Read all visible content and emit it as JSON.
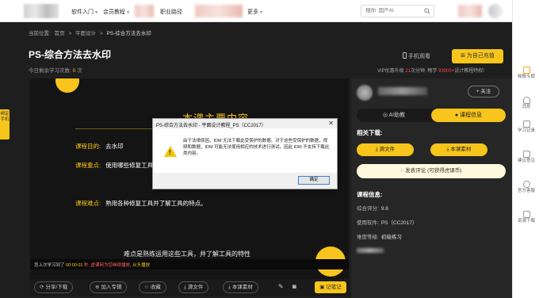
{
  "nav": {
    "items": [
      "软件入门",
      "会员教程",
      "职业路径",
      "更多"
    ],
    "search_placeholder": "搜你: 国产AI"
  },
  "right_sidebar": {
    "items": [
      "释教专题",
      "消息",
      "学习记录",
      "建议意见",
      "官方客服",
      "资源下载"
    ]
  },
  "left_tab": {
    "label": "绑定手机"
  },
  "breadcrumb": {
    "prefix": "当前位置:",
    "items": [
      "首页",
      "平面设计",
      "PS-综合方法去水印"
    ],
    "separator": ">"
  },
  "page": {
    "title": "PS-综合方法去水印",
    "study_label": "今日剩余学习次数:",
    "study_count": "0",
    "study_unit": "次",
    "mobile_watch": "手机观看",
    "vip_button": "为自己充值",
    "vip_text_pre": "VIP优惠升级",
    "vip_days": "21",
    "vip_text_mid": "次分钟, 畅学",
    "vip_count": "93000+",
    "vip_text_post": "设计教程特权!"
  },
  "video": {
    "title": "本课主要内容",
    "rows": [
      {
        "key": "课程目的:",
        "value": "去水印"
      },
      {
        "key": "课程重点:",
        "value": "使用哪些修复工具"
      },
      {
        "key": "课程难点:",
        "value": "熟用各种修复工具并了解工具的特点。"
      }
    ],
    "subtitle": "难点是熟练运用这些工具，并了解工具的特性",
    "progress": {
      "prefix": "您上次学习到了",
      "time": "00:00:01",
      "mid": "秒, 虚课网为您继续播放,",
      "go": "从头播放"
    }
  },
  "dialog": {
    "title": "PS-综合方法去水印 - 平面设计教程_PS（CC2017）",
    "close": "✕",
    "message": "由于法律原因，IDM 无法下载此受保护的数据。对于这些受保护的数据，视频和数据，IDM 可能无法使用相应的技术进行测试，因此 IDM 不支持下载此类内容。",
    "ok": "确定"
  },
  "toolbar": {
    "buttons": [
      "分享/下载",
      "加入专辑",
      "收藏",
      "源文件",
      "本课素材"
    ],
    "notes": "记笔记"
  },
  "right_panel": {
    "follow": "+ 关注",
    "tabs": [
      "AI助教",
      "课程信息"
    ],
    "related_title": "相关下载:",
    "source_btn": "源文件",
    "material_btn": "本课素材",
    "comment_btn": "发表评论 (可获得虎课币)",
    "info_title": "课程信息:",
    "info": [
      {
        "label": "综合评分:",
        "value": "9.8"
      },
      {
        "label": "使用软件:",
        "value": "PS（CC2017）"
      },
      {
        "label": "难度等级:",
        "value": "初级练习"
      }
    ]
  },
  "colors": {
    "accent": "#f7c51b",
    "background": "#1e1e1e",
    "panel": "#262626",
    "highlight_red": "#ff4a4a"
  }
}
